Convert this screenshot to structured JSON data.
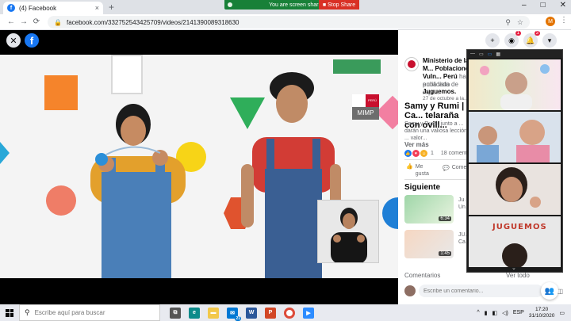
{
  "browser": {
    "tab_title": "(4) Facebook",
    "tab_favicon": "f",
    "tab_close": "×",
    "new_tab": "+",
    "url": "facebook.com/332752543425709/videos/2141390089318630",
    "sharing_text": "You are screen sharing",
    "stop_share": "Stop Share",
    "profile_initial": "M"
  },
  "video": {
    "logo_badge_peru": "PERÚ",
    "logo_label": "MIMP"
  },
  "post": {
    "page_name": "Ministerio de la M... Poblaciones Vuln... Perú",
    "published_label": "ha publicado",
    "list_label": "en la lista de repr...",
    "list_name": "Juguemos.",
    "date": "27 de octubre a la...",
    "title": "Samy y Rumi | Ca... telaraña con ovill...",
    "description": "Samy y Rumi, junto a ... darán una valiosa lección ... valor...",
    "see_more": "Ver más",
    "reaction_count": "1",
    "comments_count": "18 comentar...",
    "like_label": "Me gusta",
    "comment_label": "Comen..."
  },
  "next": {
    "heading": "Siguiente",
    "items": [
      {
        "duration": "6:34",
        "title": "Ju... Un..."
      },
      {
        "duration": "1:45",
        "title": "JU... Ca..."
      }
    ]
  },
  "comments": {
    "label": "Comentarios",
    "see_all": "Ver todo",
    "placeholder": "Escribe un comentario..."
  },
  "zoom": {
    "tile_label": "JUGUEMOS"
  },
  "taskbar": {
    "search_placeholder": "Escribe aquí para buscar",
    "badge_count": "21",
    "language": "ESP",
    "time": "17:20",
    "date": "31/10/2020"
  },
  "notifications": {
    "messenger_count": "1",
    "bell_count": "3"
  },
  "colors": {
    "facebook_blue": "#1877f2",
    "share_green": "#188038",
    "stop_red": "#d93025"
  }
}
